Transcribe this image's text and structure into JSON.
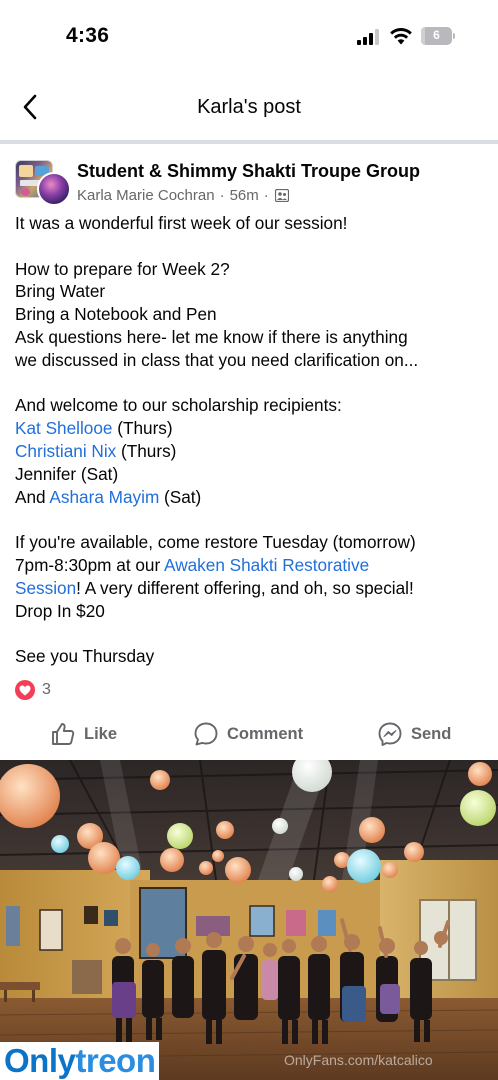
{
  "status_bar": {
    "time": "4:36",
    "battery_level": "6"
  },
  "header": {
    "title": "Karla's post",
    "back_icon": "chevron-left-icon"
  },
  "post": {
    "group_name": "Student & Shimmy Shakti Troupe Group",
    "author": "Karla Marie Cochran",
    "separator": "·",
    "time_ago": "56m",
    "audience_icon": "group-audience-icon",
    "lines": {
      "l1": "It was a wonderful first week of our session!",
      "l2": "How to prepare for Week 2?",
      "l3": "Bring Water",
      "l4": "Bring a Notebook and Pen",
      "l5": "Ask questions here- let me know if there is anything",
      "l6": "we discussed in class that you need clarification on...",
      "l7": "And welcome to our scholarship recipients:",
      "r1_name": "Kat Shellooe",
      "r1_day": " (Thurs)",
      "r2_name": "Christiani Nix",
      "r2_day": " (Thurs)",
      "r3": "Jennifer (Sat)",
      "r4_prefix": "And ",
      "r4_name": "Ashara Mayim",
      "r4_day": " (Sat)",
      "l8": "If you're available, come restore Tuesday (tomorrow)",
      "l9_prefix": "7pm-8:30pm at our ",
      "l9_link": "Awaken Shakti Restorative",
      "l10_link": "Session",
      "l10_suffix": "! A very different offering, and oh, so special!",
      "l11": "Drop In $20",
      "l12": "See you Thursday"
    },
    "reaction": {
      "icon": "heart-icon",
      "count": "3"
    }
  },
  "actions": {
    "like": {
      "label": "Like",
      "icon": "thumbs-up-icon"
    },
    "comment": {
      "label": "Comment",
      "icon": "comment-bubble-icon"
    },
    "send": {
      "label": "Send",
      "icon": "messenger-icon"
    }
  },
  "photo": {
    "alt_subject": "group photo of dance troupe in studio with paper lanterns"
  },
  "watermark": {
    "brand_left": "Only",
    "brand_right": "treon",
    "url": "OnlyFans.com/katcalico"
  },
  "colors": {
    "link": "#216fdb",
    "meta": "#65676b",
    "love": "#f33e58",
    "divider": "#dadde1"
  }
}
